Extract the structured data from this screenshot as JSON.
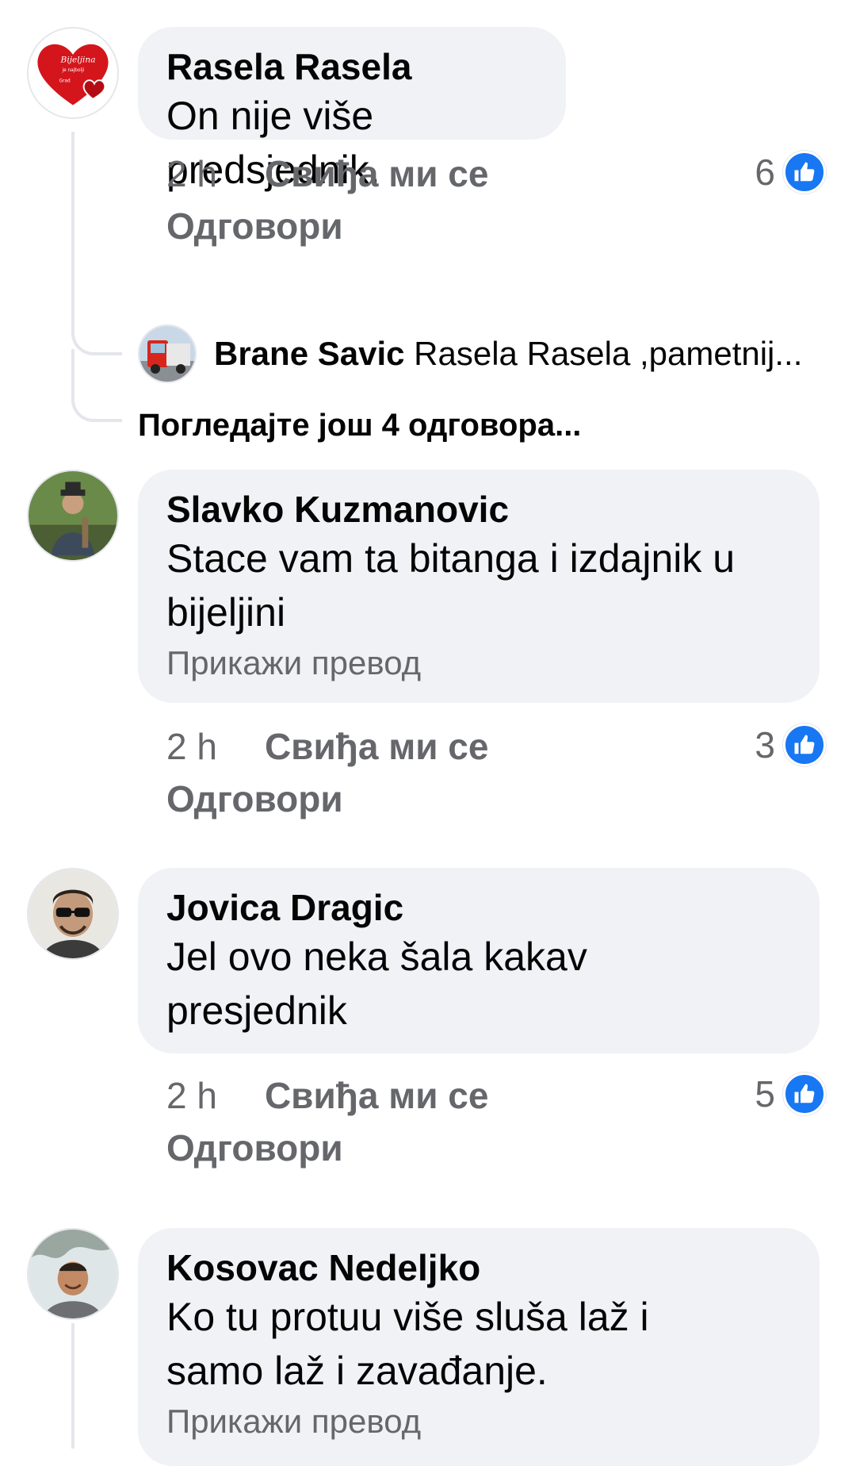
{
  "comments": [
    {
      "author": "Rasela Rasela",
      "text": "On nije više predsjednik.",
      "time": "2 h",
      "like_label": "Свиђа ми се",
      "reply_label": "Одговори",
      "reaction_count": "6",
      "avatar_text": [
        "Bijeljina",
        "je najbolji",
        "Grad"
      ]
    },
    {
      "author": "Slavko Kuzmanovic",
      "text_lines": [
        "Stace vam ta bitanga i izdajnik u",
        "bijeljini"
      ],
      "translate_label": "Прикажи превод",
      "time": "2 h",
      "like_label": "Свиђа ми се",
      "reply_label": "Одговори",
      "reaction_count": "3"
    },
    {
      "author": "Jovica Dragic",
      "text_lines": [
        "Jel ovo neka šala kakav",
        "presjednik"
      ],
      "time": "2 h",
      "like_label": "Свиђа ми се",
      "reply_label": "Одговори",
      "reaction_count": "5"
    },
    {
      "author": "Kosovac Nedeljko",
      "text_lines": [
        "Ko tu protuu više sluša laž i",
        "samo laž i zavađanje."
      ],
      "translate_label": "Прикажи превод"
    }
  ],
  "nested_reply": {
    "author": "Brane Savic",
    "preview": "Rasela Rasela ,pametnij..."
  },
  "more_replies_label": "Погледајте још 4 одговора...",
  "colors": {
    "bubble": "#f0f2f5",
    "secondary_text": "#65676b",
    "like_blue": "#1877f2",
    "thread_line": "#e4e6eb"
  },
  "icons": [
    "thumbs-up-icon"
  ]
}
